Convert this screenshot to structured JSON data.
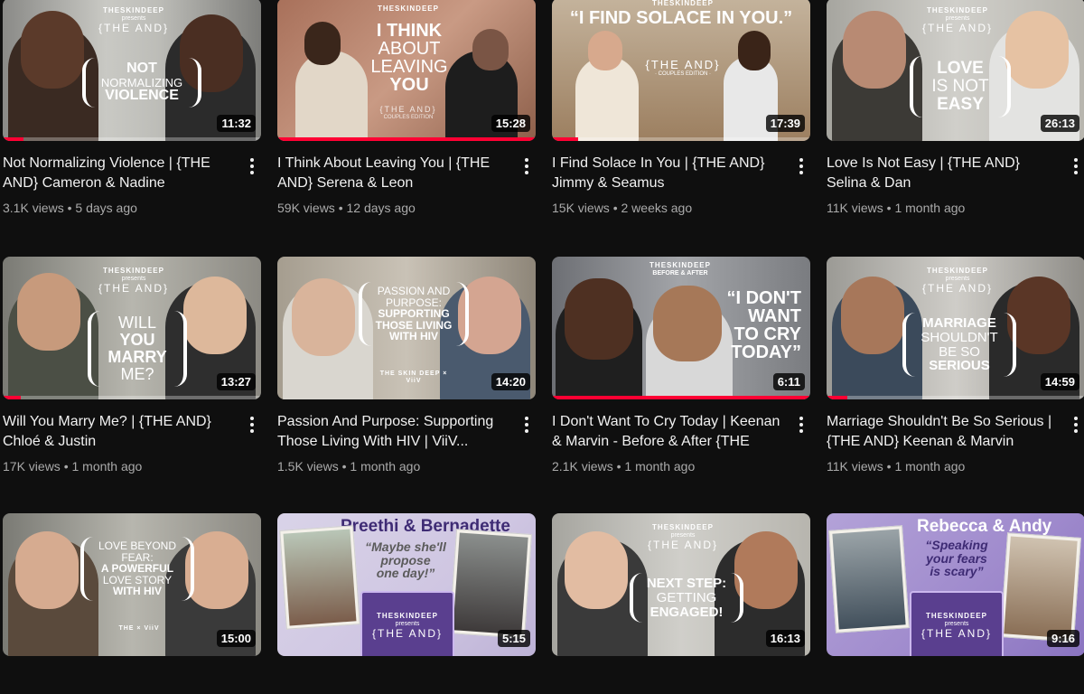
{
  "videos": [
    {
      "title": "Not Normalizing Violence | {THE AND} Cameron & Nadine",
      "views": "3.1K views",
      "age": "5 days ago",
      "duration": "11:32",
      "progress": 0.08,
      "thumb": {
        "brand": "THESKINDEEP",
        "presents": "presents",
        "and": "{THE AND}",
        "lines": [
          "NOT",
          "NORMALIZING",
          "VIOLENCE"
        ]
      }
    },
    {
      "title": "I Think About Leaving You | {THE AND} Serena & Leon",
      "views": "59K views",
      "age": "12 days ago",
      "duration": "15:28",
      "progress": 1.0,
      "thumb": {
        "brand": "THESKINDEEP",
        "lines": [
          "I THINK",
          "ABOUT",
          "LEAVING",
          "YOU"
        ],
        "and": "{THE AND}",
        "edition": "COUPLES EDITION"
      }
    },
    {
      "title": "I Find Solace In You | {THE AND} Jimmy & Seamus",
      "views": "15K views",
      "age": "2 weeks ago",
      "duration": "17:39",
      "progress": 0.1,
      "thumb": {
        "brand": "THESKINDEEP",
        "quote": "“I FIND SOLACE IN YOU.”",
        "and": "{THE AND}",
        "edition": "· COUPLES EDITION ·"
      }
    },
    {
      "title": "Love Is Not Easy | {THE AND} Selina & Dan",
      "views": "11K views",
      "age": "1 month ago",
      "duration": "26:13",
      "progress": 0,
      "thumb": {
        "brand": "THESKINDEEP",
        "presents": "presents",
        "and": "{THE AND}",
        "lines": [
          "LOVE",
          "IS NOT",
          "EASY"
        ]
      }
    },
    {
      "title": "Will You Marry Me? | {THE AND} Chloé & Justin",
      "views": "17K views",
      "age": "1 month ago",
      "duration": "13:27",
      "progress": 0.07,
      "thumb": {
        "brand": "THESKINDEEP",
        "presents": "presents",
        "and": "{THE AND}",
        "lines": [
          "WILL",
          "YOU",
          "MARRY",
          "ME?"
        ]
      }
    },
    {
      "title": "Passion And Purpose: Supporting Those Living With HIV | ViiV...",
      "views": "1.5K views",
      "age": "1 month ago",
      "duration": "14:20",
      "progress": 0,
      "thumb": {
        "lines": [
          "PASSION AND",
          "PURPOSE:",
          "SUPPORTING",
          "THOSE LIVING",
          "WITH HIV"
        ],
        "logo_left": "THE SKIN DEEP",
        "logo_x": "×",
        "logo_right": "ViiV"
      }
    },
    {
      "title": "I Don't Want To Cry Today | Keenan & Marvin - Before & After {THE AND}",
      "views": "2.1K views",
      "age": "1 month ago",
      "duration": "6:11",
      "progress": 1.0,
      "thumb": {
        "brand": "THESKINDEEP",
        "sub": "BEFORE & AFTER",
        "quote": [
          "“I DON'T",
          "WANT",
          "TO CRY",
          "TODAY”"
        ]
      }
    },
    {
      "title": "Marriage Shouldn't Be So Serious | {THE AND} Keenan & Marvin",
      "views": "11K views",
      "age": "1 month ago",
      "duration": "14:59",
      "progress": 0.08,
      "thumb": {
        "brand": "THESKINDEEP",
        "presents": "presents",
        "and": "{THE AND}",
        "lines": [
          "MARRIAGE",
          "SHOULDN'T",
          "BE SO",
          "SERIOUS"
        ]
      }
    },
    {
      "title": "",
      "views": "",
      "age": "",
      "duration": "15:00",
      "progress": 0,
      "thumb": {
        "lines": [
          "LOVE BEYOND",
          "FEAR:",
          "A POWERFUL",
          "LOVE STORY",
          "WITH HIV"
        ],
        "logo_left": "THE",
        "logo_x": "×",
        "logo_right": "ViiV"
      }
    },
    {
      "title": "",
      "views": "",
      "age": "",
      "duration": "5:15",
      "progress": 0,
      "thumb": {
        "names": "Preethi & Bernadette",
        "quote": [
          "“Maybe she'll",
          "propose",
          "one day!”"
        ],
        "brand": "THESKINDEEP",
        "presents": "presents",
        "and": "{THE AND}"
      }
    },
    {
      "title": "",
      "views": "",
      "age": "",
      "duration": "16:13",
      "progress": 0,
      "thumb": {
        "brand": "THESKINDEEP",
        "presents": "presents",
        "and": "{THE AND}",
        "lines": [
          "NEXT STEP:",
          "GETTING",
          "ENGAGED!"
        ]
      }
    },
    {
      "title": "",
      "views": "",
      "age": "",
      "duration": "9:16",
      "progress": 0,
      "thumb": {
        "names": "Rebecca & Andy",
        "quote": [
          "“Speaking",
          "your fears",
          "is scary”"
        ],
        "brand": "THESKINDEEP",
        "presents": "presents",
        "and": "{THE AND}"
      }
    }
  ],
  "colors": {
    "background": "#0f0f0f",
    "progress": "#ff0033",
    "meta": "#aaaaaa"
  },
  "icons": {
    "menu": "more-vert-icon"
  }
}
